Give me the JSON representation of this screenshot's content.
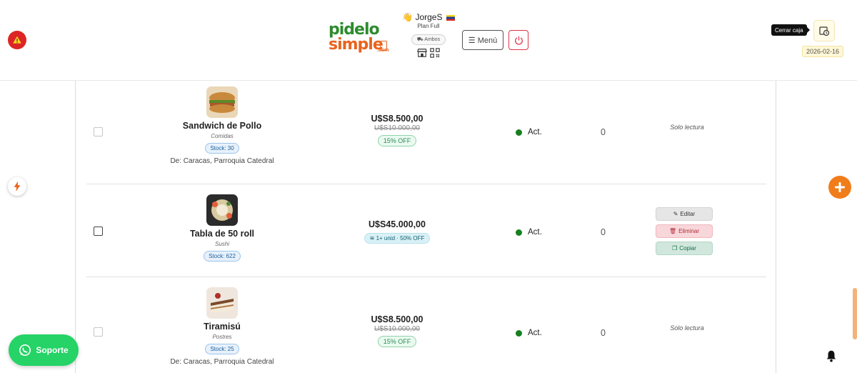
{
  "header": {
    "logo": {
      "line1": "pidelo",
      "line2": "simple",
      "suffix": ".com"
    },
    "user": {
      "wave": "👋",
      "name": "JorgeS",
      "plan": "Plan Full",
      "mode": "Ambos"
    },
    "menu_label": "☰ Menú",
    "tooltip": "Cerrar caja",
    "date": "2026-02-16"
  },
  "products": [
    {
      "name": "Sandwich de Pollo",
      "category": "Comidas",
      "stock": "Stock: 30",
      "location": "De: Caracas, Parroquia Catedral",
      "price": "U$S8.500,00",
      "old_price": "U$S10.000,00",
      "discount": "15% OFF",
      "status": "Act.",
      "count": "0",
      "note": "Solo lectura"
    },
    {
      "name": "Tabla de 50 roll",
      "category": "Sushi",
      "stock": "Stock: 622",
      "price": "U$S45.000,00",
      "promo": "1+ unid · 50% OFF",
      "status": "Act.",
      "count": "0",
      "actions": {
        "edit": "Editar",
        "delete": "Eliminar",
        "copy": "Copiar"
      }
    },
    {
      "name": "Tiramisú",
      "category": "Postres",
      "stock": "Stock: 25",
      "location": "De: Caracas, Parroquia Catedral",
      "price": "U$S8.500,00",
      "old_price": "U$S10.000,00",
      "discount": "15% OFF",
      "status": "Act.",
      "count": "0",
      "note": "Solo lectura"
    }
  ],
  "support": {
    "label": "Soporte"
  },
  "colors": {
    "brand_green": "#2e8b2e",
    "brand_orange": "#e8641e",
    "active_dot": "#16801f",
    "whatsapp": "#25d366",
    "fab": "#f07d1a",
    "danger": "#dc3545"
  },
  "icons": [
    "warning-icon",
    "hand-wave-icon",
    "flag-icon",
    "store-icon",
    "qr-code-icon",
    "menu-icon",
    "power-icon",
    "cash-register-icon",
    "bolt-icon",
    "plus-icon",
    "whatsapp-icon",
    "bell-icon",
    "edit-icon",
    "trash-icon",
    "copy-icon",
    "layers-icon"
  ]
}
